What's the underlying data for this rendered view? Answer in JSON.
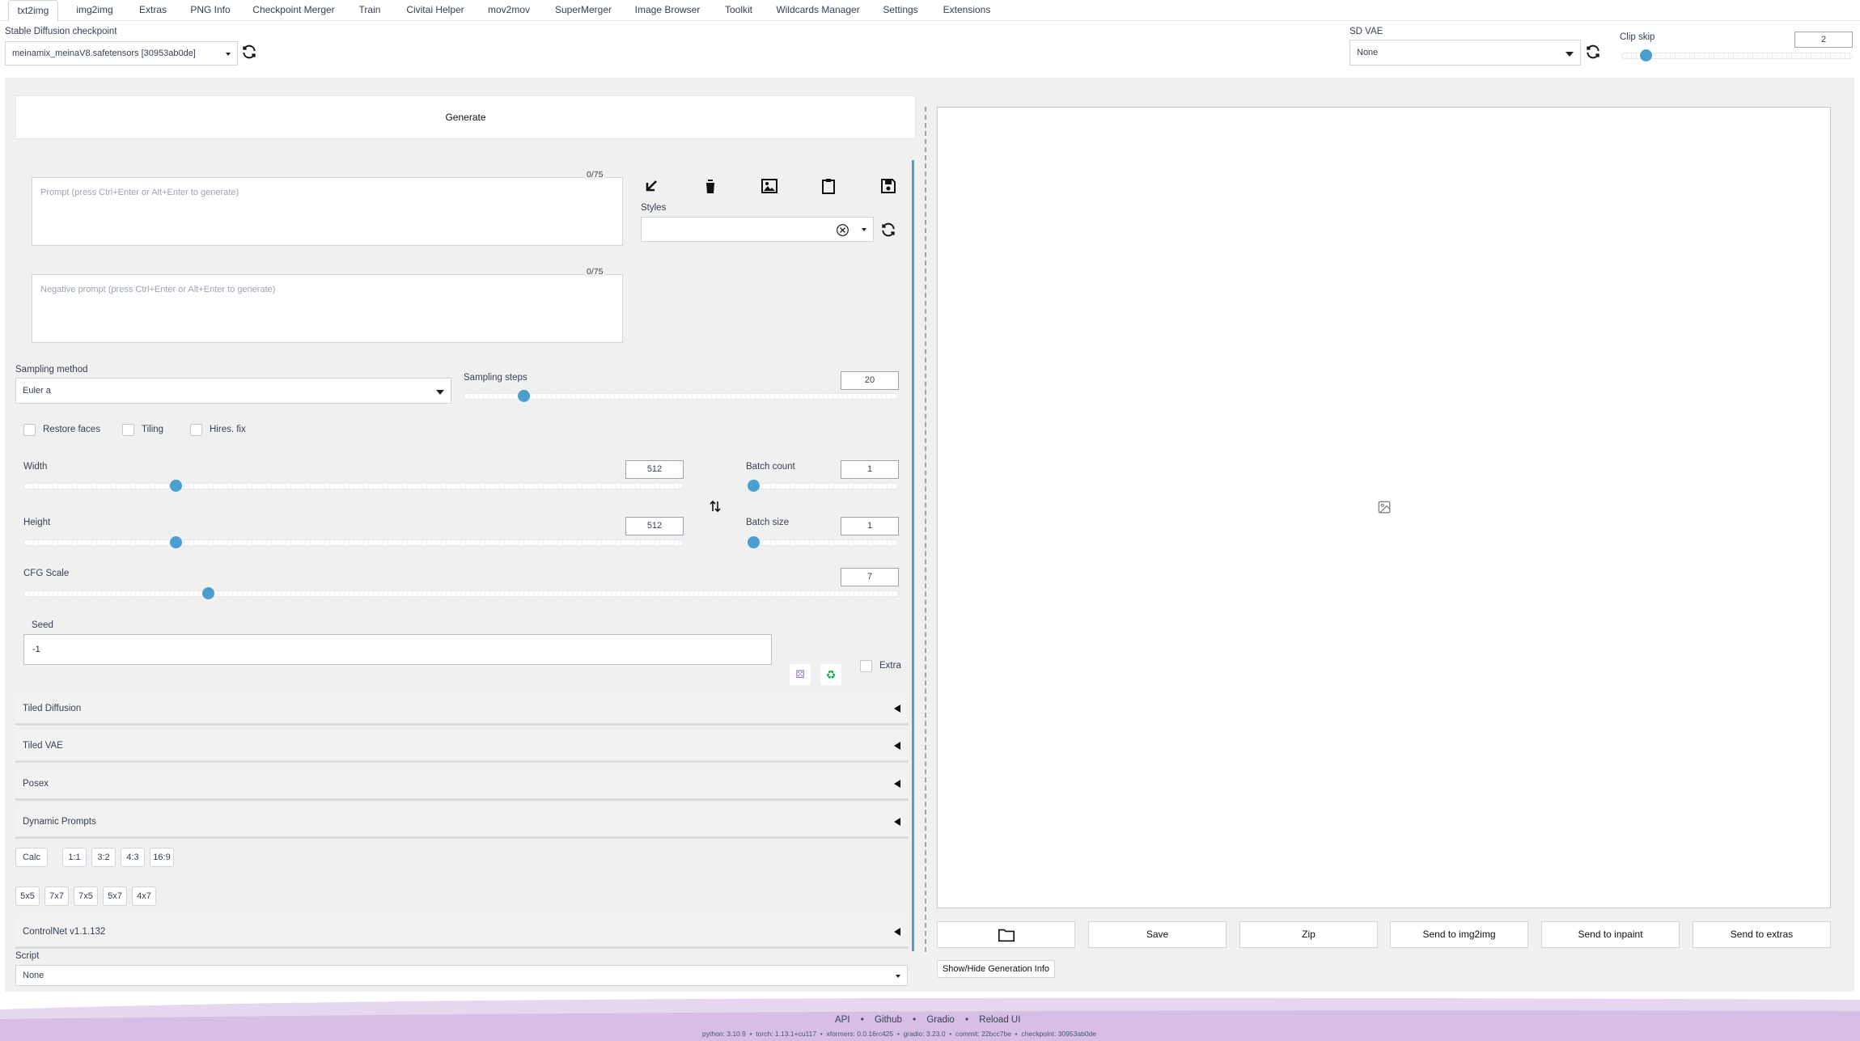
{
  "tabs": [
    "txt2img",
    "img2img",
    "Extras",
    "PNG Info",
    "Checkpoint Merger",
    "Train",
    "Civitai Helper",
    "mov2mov",
    "SuperMerger",
    "Image Browser",
    "Toolkit",
    "Wildcards Manager",
    "Settings",
    "Extensions"
  ],
  "checkpoint": {
    "label": "Stable Diffusion checkpoint",
    "value": "meinamix_meinaV8.safetensors [30953ab0de]"
  },
  "vae": {
    "label": "SD VAE",
    "value": "None"
  },
  "clip_skip": {
    "label": "Clip skip",
    "value": "2",
    "level": 0.02
  },
  "generate_label": "Generate",
  "prompt": {
    "placeholder": "Prompt (press Ctrl+Enter or Alt+Enter to generate)",
    "counter": "0/75"
  },
  "negative_prompt": {
    "placeholder": "Negative prompt (press Ctrl+Enter or Alt+Enter to generate)",
    "counter": "0/75"
  },
  "styles_label": "Styles",
  "sampling": {
    "method_label": "Sampling method",
    "method_value": "Euler a",
    "steps_label": "Sampling steps",
    "steps_value": "20"
  },
  "checks": {
    "restore_faces": "Restore faces",
    "tiling": "Tiling",
    "hires_fix": "Hires. fix",
    "extra": "Extra"
  },
  "width": {
    "label": "Width",
    "value": "512"
  },
  "height": {
    "label": "Height",
    "value": "512"
  },
  "batch_count": {
    "label": "Batch count",
    "value": "1"
  },
  "batch_size": {
    "label": "Batch size",
    "value": "1"
  },
  "cfg": {
    "label": "CFG Scale",
    "value": "7"
  },
  "seed": {
    "label": "Seed",
    "value": "-1"
  },
  "accordions": {
    "tiled_diffusion": "Tiled Diffusion",
    "tiled_vae": "Tiled VAE",
    "posex": "Posex",
    "dynamic_prompts": "Dynamic Prompts",
    "controlnet": "ControlNet v1.1.132"
  },
  "aspect_buttons": [
    "Calc",
    "1:1",
    "3:2",
    "4:3",
    "16:9"
  ],
  "grid_buttons": [
    "5x5",
    "7x7",
    "7x5",
    "5x7",
    "4x7"
  ],
  "script": {
    "label": "Script",
    "value": "None"
  },
  "output_buttons": {
    "save": "Save",
    "zip": "Zip",
    "send_img2img": "Send to img2img",
    "send_inpaint": "Send to inpaint",
    "send_extras": "Send to extras"
  },
  "show_hide_info": "Show/Hide Generation Info",
  "footer": {
    "links": [
      "API",
      "Github",
      "Gradio",
      "Reload UI"
    ],
    "versions": "python: 3.10.9  •  torch: 1.13.1+cu117  •  xformers: 0.0.16rc425  •  gradio: 3.23.0  •  commit: 22bcc7be  •  checkpoint: 30953ab0de"
  },
  "colors": {
    "accent": "#4b9ed0",
    "footer": "#d9c3e6"
  }
}
